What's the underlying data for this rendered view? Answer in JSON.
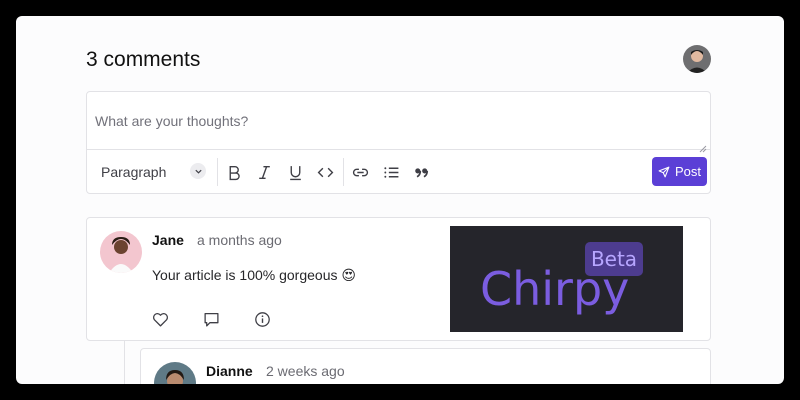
{
  "header": {
    "title": "3 comments"
  },
  "editor": {
    "placeholder": "What are your thoughts?",
    "block_type": "Paragraph",
    "tools": [
      "bold-icon",
      "italic-icon",
      "underline-icon",
      "code-icon",
      "link-icon",
      "list-icon",
      "quote-icon"
    ],
    "post_label": "Post"
  },
  "comments": [
    {
      "author": "Jane",
      "time": "a months ago",
      "text": "Your article is 100% gorgeous 😍",
      "image": {
        "wordmark": "Chirpy",
        "badge": "Beta"
      },
      "actions": [
        "heart-icon",
        "reply-icon",
        "info-icon"
      ]
    }
  ],
  "replies": [
    {
      "author": "Dianne",
      "time": "2 weeks ago"
    }
  ],
  "colors": {
    "accent": "#5b3fd6",
    "border": "#e2e2e6",
    "brand_purple": "#7b5de0"
  }
}
